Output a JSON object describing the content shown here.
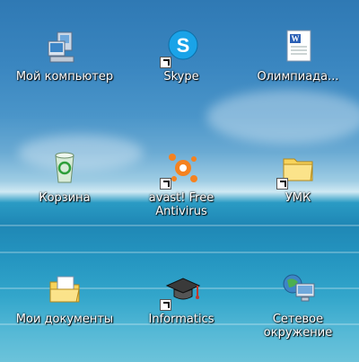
{
  "desktop": {
    "icons": [
      {
        "label": "Мой компьютер",
        "icon": "computer-icon"
      },
      {
        "label": "Skype",
        "icon": "skype-icon"
      },
      {
        "label": "Олимпиада...",
        "icon": "word-document-icon"
      },
      {
        "label": "Корзина",
        "icon": "recycle-bin-icon"
      },
      {
        "label": "avast! Free Antivirus",
        "icon": "avast-icon"
      },
      {
        "label": "УМК",
        "icon": "folder-icon"
      },
      {
        "label": "Мои документы",
        "icon": "my-documents-icon"
      },
      {
        "label": "Informatics",
        "icon": "graduation-cap-icon"
      },
      {
        "label": "Сетевое окружение",
        "icon": "network-icon"
      }
    ]
  },
  "colors": {
    "label_text": "#ffffff",
    "skype_blue": "#1aa3e8",
    "avast_orange": "#f58220",
    "folder_yellow": "#f7d35b"
  }
}
